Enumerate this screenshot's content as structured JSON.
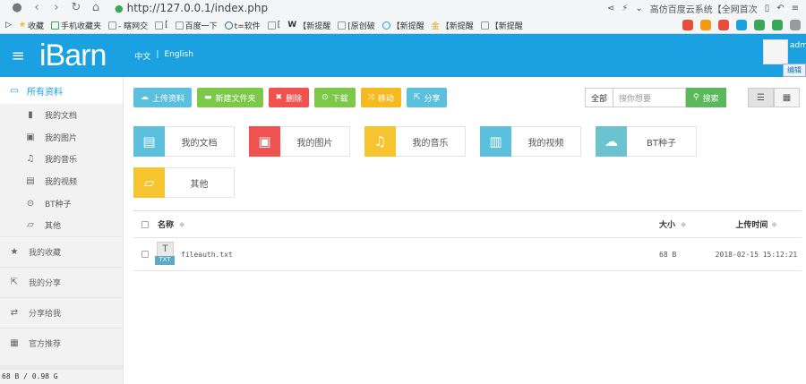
{
  "browser": {
    "url": "http://127.0.0.1/index.php",
    "right_text": "高仿百度云系统【全网首次",
    "bookmarks": [
      "收藏",
      "手机收藏夹",
      "- 瞎网交",
      "[",
      "百度一下",
      "t=软件",
      "[",
      "【新提醒",
      "[原创破",
      "【新提醒",
      "【新提醒",
      "【新提醒"
    ]
  },
  "app": {
    "logo": "iBarn",
    "lang": {
      "zh": "中文",
      "sep": "|",
      "en": "English"
    },
    "user": {
      "name": "admin",
      "dropdown": "编辑"
    }
  },
  "sidebar": {
    "head": "所有资料",
    "sub_items": [
      "我的文档",
      "我的图片",
      "我的音乐",
      "我的视频",
      "BT种子",
      "其他"
    ],
    "main_items": [
      "我的收藏",
      "我的分享",
      "分享给我",
      "官方推荐"
    ],
    "usage": "68 B / 0.98 G"
  },
  "toolbar": {
    "buttons": [
      {
        "label": "上传资料",
        "color": "#5bc0de"
      },
      {
        "label": "新建文件夹",
        "color": "#7cc94a"
      },
      {
        "label": "删除",
        "color": "#f0524f"
      },
      {
        "label": "下载",
        "color": "#7cc94a"
      },
      {
        "label": "移动",
        "color": "#f5b922"
      },
      {
        "label": "分享",
        "color": "#5bc0de"
      }
    ],
    "search_scope": "全部",
    "search_placeholder": "搜你想要",
    "search_button": "搜索"
  },
  "categories": [
    {
      "label": "我的文档",
      "color": "#5bc0de",
      "icon": "document-icon"
    },
    {
      "label": "我的图片",
      "color": "#f0524f",
      "icon": "picture-icon"
    },
    {
      "label": "我的音乐",
      "color": "#f5c42f",
      "icon": "music-icon"
    },
    {
      "label": "我的视频",
      "color": "#5bc0de",
      "icon": "film-icon"
    },
    {
      "label": "BT种子",
      "color": "#6bc3cf",
      "icon": "cloud-download-icon"
    },
    {
      "label": "其他",
      "color": "#f5c42f",
      "icon": "folder-icon"
    }
  ],
  "table": {
    "headers": {
      "name": "名称",
      "size": "大小",
      "time": "上传时间"
    },
    "rows": [
      {
        "name": "fileauth.txt",
        "size": "68 B",
        "time": "2018-02-15 15:12:21",
        "type": "TXT"
      }
    ]
  }
}
